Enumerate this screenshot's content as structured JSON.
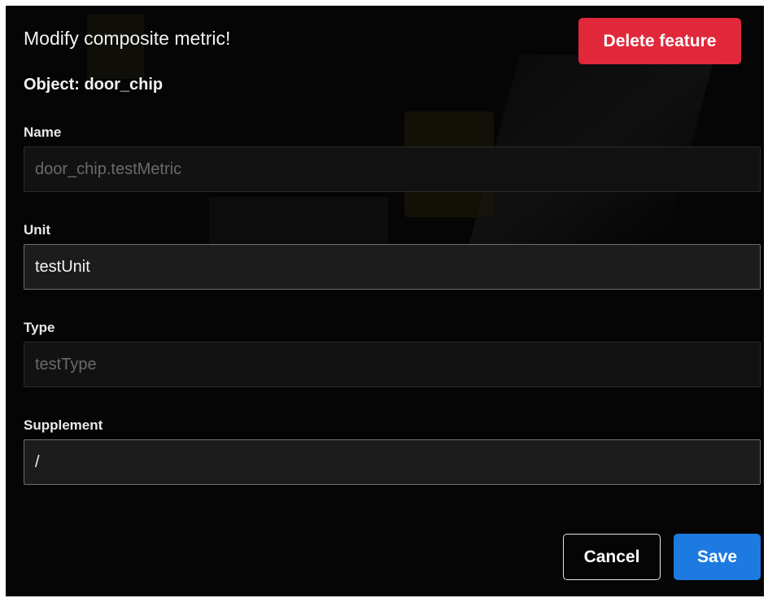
{
  "dialog": {
    "title": "Modify composite metric!",
    "object_line": "Object: door_chip",
    "delete_label": "Delete feature"
  },
  "fields": {
    "name": {
      "label": "Name",
      "value": "door_chip.testMetric",
      "editable": false
    },
    "unit": {
      "label": "Unit",
      "value": "testUnit",
      "editable": true
    },
    "type": {
      "label": "Type",
      "value": "testType",
      "editable": false
    },
    "supplement": {
      "label": "Supplement",
      "value": "/",
      "editable": true
    }
  },
  "footer": {
    "cancel_label": "Cancel",
    "save_label": "Save"
  },
  "colors": {
    "background": "#050505",
    "danger": "#e0283a",
    "primary": "#1c7ae0"
  }
}
